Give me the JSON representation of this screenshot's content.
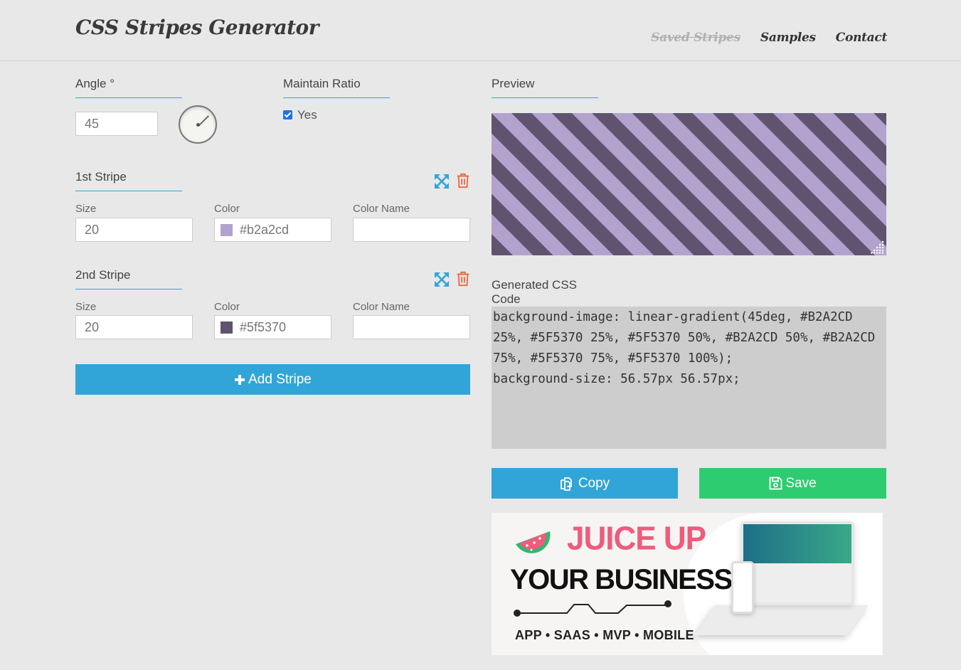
{
  "header": {
    "logo": "CSS Stripes Generator",
    "nav": [
      {
        "label": "Saved Stripes",
        "disabled": true
      },
      {
        "label": "Samples",
        "disabled": false
      },
      {
        "label": "Contact",
        "disabled": false
      }
    ]
  },
  "angle": {
    "title": "Angle °",
    "value": "45"
  },
  "ratio": {
    "title": "Maintain Ratio",
    "checked": true,
    "label": "Yes"
  },
  "stripes": [
    {
      "title": "1st Stripe",
      "size_label": "Size",
      "size": "20",
      "color_label": "Color",
      "color": "#b2a2cd",
      "name_label": "Color Name",
      "name": ""
    },
    {
      "title": "2nd Stripe",
      "size_label": "Size",
      "size": "20",
      "color_label": "Color",
      "color": "#5f5370",
      "name_label": "Color Name",
      "name": ""
    }
  ],
  "add_stripe": "Add Stripe",
  "preview": {
    "title": "Preview"
  },
  "code": {
    "title": "Generated CSS Code",
    "text": "background-image: linear-gradient(45deg, #B2A2CD 25%, #5F5370 25%, #5F5370 50%, #B2A2CD 50%, #B2A2CD 75%, #5F5370 75%, #5F5370 100%);\nbackground-size: 56.57px 56.57px;"
  },
  "actions": {
    "copy": "Copy",
    "save": "Save"
  },
  "ad": {
    "headline1": "JUICE UP",
    "headline2": "YOUR BUSINESS",
    "tags": "APP • SAAS • MVP • MOBILE"
  },
  "colors": {
    "accent": "#31a5d8",
    "save": "#2ecc71",
    "delete": "#e8663c"
  }
}
